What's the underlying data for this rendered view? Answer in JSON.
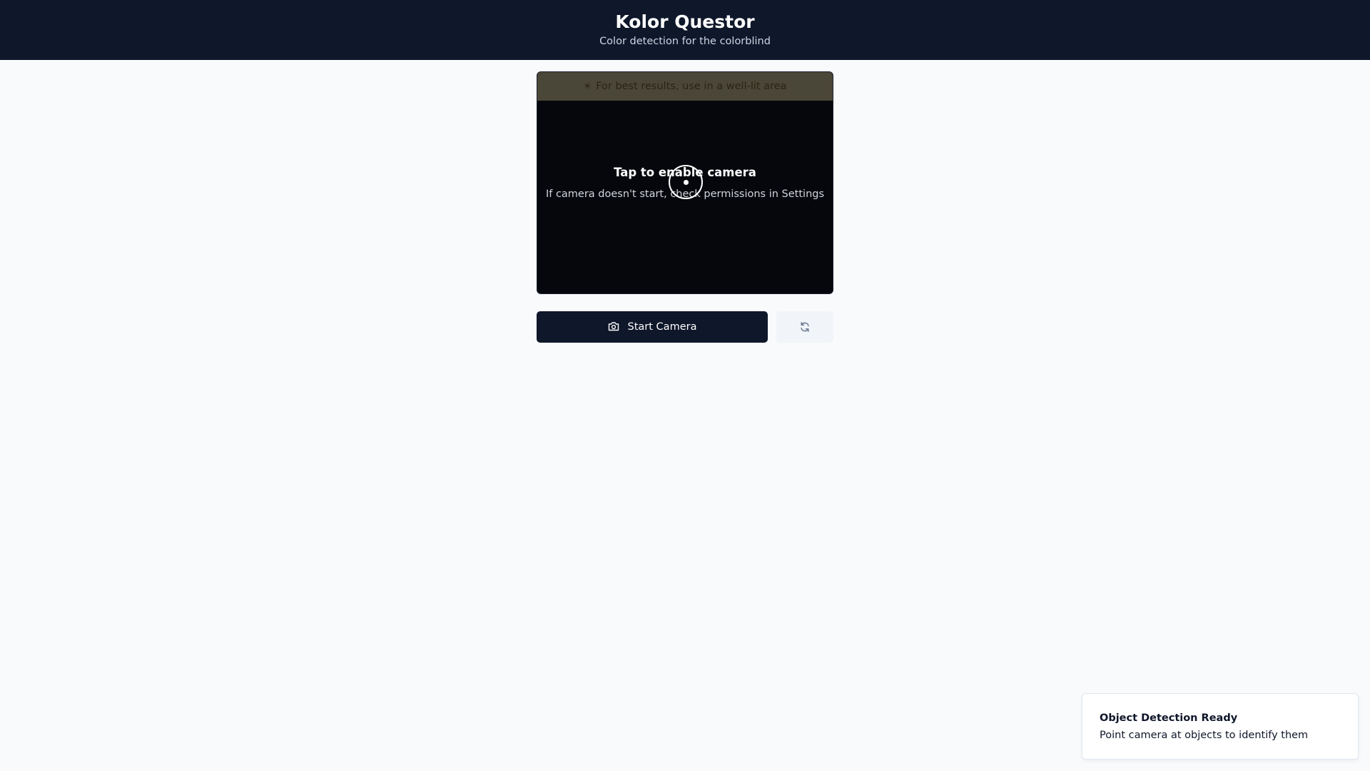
{
  "header": {
    "title": "Kolor Questor",
    "subtitle": "Color detection for the colorblind"
  },
  "camera": {
    "tip": "For best results, use in a well-lit area",
    "tip_icon": "sun-icon",
    "prompt_title": "Tap to enable camera",
    "prompt_subtitle": "If camera doesn't start, check permissions in Settings"
  },
  "controls": {
    "start_label": "Start Camera",
    "start_icon": "camera-icon",
    "refresh_icon": "refresh-icon"
  },
  "toast": {
    "title": "Object Detection Ready",
    "message": "Point camera at objects to identify them"
  },
  "colors": {
    "header_bg": "#0f172a",
    "page_bg": "#f8fafc",
    "tip_bg": "#4a4638",
    "camera_bg": "#05070c",
    "button_primary": "#0f172a",
    "button_secondary": "#f1f5f9"
  }
}
